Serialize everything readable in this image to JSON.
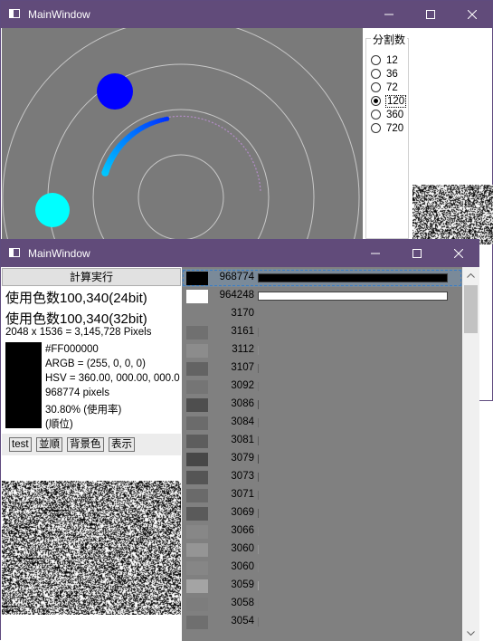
{
  "window1": {
    "title": "MainWindow",
    "group_label": "分割数",
    "options": [
      "12",
      "36",
      "72",
      "120",
      "360",
      "720"
    ],
    "selected": "120"
  },
  "window2": {
    "title": "MainWindow",
    "run_button": "計算実行",
    "colors_24": "使用色数100,340(24bit)",
    "colors_32": "使用色数100,340(32bit)",
    "pixels_info": "2048 x 1536 = 3,145,728 Pixels",
    "hex": "#FF000000",
    "argb": "ARGB = (255, 0, 0, 0)",
    "hsv": "HSV = 360.00, 000.00, 000.0",
    "pixel_count": "968774 pixels",
    "rate": "30.80% (使用率)",
    "rank": " (順位)",
    "buttons": {
      "test": "test",
      "sort": "並順",
      "bg": "背景色",
      "show": "表示"
    },
    "list_rows": [
      {
        "count": "968774",
        "color": "#000000",
        "bar": 1.0
      },
      {
        "count": "964248",
        "color": "#ffffff",
        "bar": 1.0
      },
      {
        "count": "3170",
        "color": "#808080",
        "bar": 0.003
      },
      {
        "count": "3161",
        "color": "#707070",
        "bar": 0.003
      },
      {
        "count": "3112",
        "color": "#8c8c8c",
        "bar": 0.003
      },
      {
        "count": "3107",
        "color": "#636363",
        "bar": 0.003
      },
      {
        "count": "3092",
        "color": "#757575",
        "bar": 0.003
      },
      {
        "count": "3086",
        "color": "#4e4e4e",
        "bar": 0.003
      },
      {
        "count": "3084",
        "color": "#6b6b6b",
        "bar": 0.003
      },
      {
        "count": "3081",
        "color": "#5d5d5d",
        "bar": 0.003
      },
      {
        "count": "3079",
        "color": "#474747",
        "bar": 0.003
      },
      {
        "count": "3073",
        "color": "#555555",
        "bar": 0.003
      },
      {
        "count": "3071",
        "color": "#6a6a6a",
        "bar": 0.003
      },
      {
        "count": "3069",
        "color": "#5a5a5a",
        "bar": 0.003
      },
      {
        "count": "3066",
        "color": "#878787",
        "bar": 0.003
      },
      {
        "count": "3060",
        "color": "#959595",
        "bar": 0.003
      },
      {
        "count": "3060",
        "color": "#868686",
        "bar": 0.003
      },
      {
        "count": "3059",
        "color": "#a4a4a4",
        "bar": 0.003
      },
      {
        "count": "3058",
        "color": "#7d7d7d",
        "bar": 0.003
      },
      {
        "count": "3054",
        "color": "#6f6f6f",
        "bar": 0.003
      }
    ]
  }
}
